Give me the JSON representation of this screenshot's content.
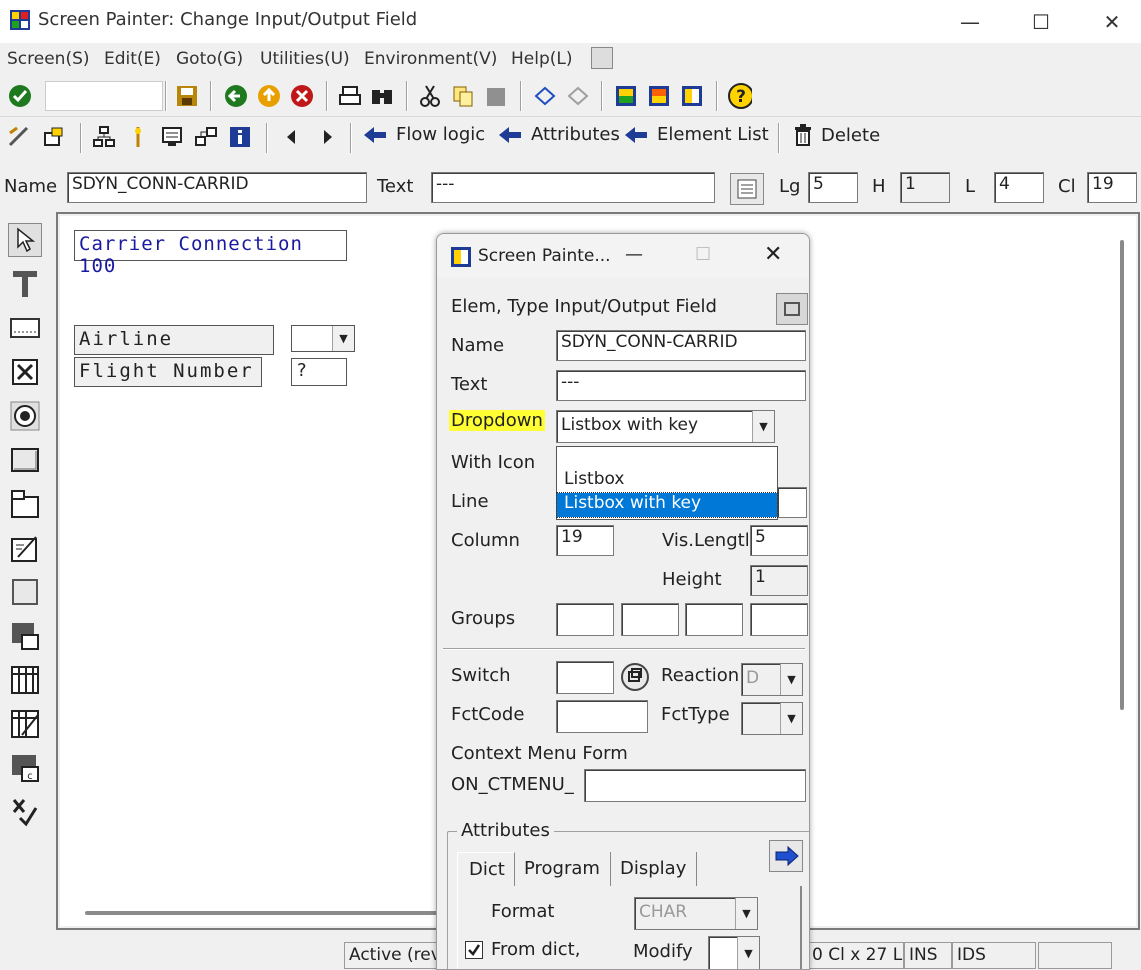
{
  "window": {
    "title": "Screen Painter:  Change Input/Output Field",
    "minimize": "—",
    "maximize": "☐",
    "close": "✕"
  },
  "menu": [
    "Screen(S)",
    "Edit(E)",
    "Goto(G)",
    "Utilities(U)",
    "Environment(V)",
    "Help(L)"
  ],
  "toolbar2": {
    "flow_logic": "Flow logic",
    "attributes": "Attributes",
    "element_list": "Element List",
    "delete": "Delete"
  },
  "namerow": {
    "name_label": "Name",
    "name_value": "SDYN_CONN-CARRID",
    "text_label": "Text",
    "text_value": "---",
    "lg_label": "Lg",
    "lg_value": "5",
    "h_label": "H",
    "h_value": "1",
    "l_label": "L",
    "l_value": "4",
    "cl_label": "Cl",
    "cl_value": "19"
  },
  "canvas": {
    "frame_title": "Carrier Connection 100",
    "airline_label": "Airline",
    "flight_label": "Flight Number",
    "flight_value": "?"
  },
  "statusbar": {
    "active": "Active (revi",
    "position": "0 Cl x 27 L",
    "ins": "INS",
    "ids": "IDS"
  },
  "dialog": {
    "title": "Screen Painte...",
    "elem_type": "Elem, Type Input/Output Field",
    "name_label": "Name",
    "name_value": "SDYN_CONN-CARRID",
    "text_label": "Text",
    "text_value": "---",
    "dropdown_label": "Dropdown",
    "dropdown_value": "Listbox with key",
    "dropdown_options": [
      "",
      "Listbox",
      "Listbox with key"
    ],
    "with_icon_label": "With Icon",
    "line_label": "Line",
    "column_label": "Column",
    "column_value": "19",
    "vislength_label": "Vis.Lengtl",
    "vislength_value": "5",
    "height_label": "Height",
    "height_value": "1",
    "groups_label": "Groups",
    "switch_label": "Switch",
    "reaction_label": "Reaction",
    "reaction_value": "D",
    "fctcode_label": "FctCode",
    "fcttype_label": "FctType",
    "context_menu_label": "Context Menu Form",
    "on_ctmenu_label": "ON_CTMENU_",
    "attributes_group": "Attributes",
    "tabs": [
      "Dict",
      "Program",
      "Display"
    ],
    "format_label": "Format",
    "format_value": "CHAR",
    "from_dict_label": "From dict,",
    "modify_label": "Modify"
  },
  "colors": {
    "highlight_yellow": "#ffff33",
    "selection_blue": "#0078d7",
    "frame_text_blue": "#1a1aa0"
  }
}
